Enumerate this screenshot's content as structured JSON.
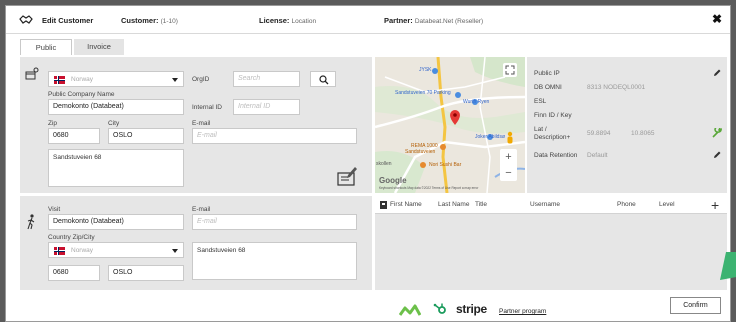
{
  "header": {
    "title": "Edit Customer",
    "customer_label": "Customer:",
    "customer_value": "(1-10)",
    "license_label": "License:",
    "license_value": "Location",
    "partner_label": "Partner:",
    "partner_value": "Databeat.Net (Reseller)",
    "close": "✖"
  },
  "tabs": [
    {
      "label": "Public"
    },
    {
      "label": "Invoice"
    }
  ],
  "company": {
    "country": "Norway",
    "orgid_label": "OrgID",
    "orgid_placeholder": "Search",
    "public_name_label": "Public Company Name",
    "public_name_value": "Demokonto (Databeat)",
    "internal_id_label": "Internal ID",
    "internal_id_placeholder": "Internal ID",
    "zip_label": "Zip",
    "zip_value": "0680",
    "city_label": "City",
    "city_value": "OSLO",
    "email_label": "E-mail",
    "email_placeholder": "E-mail",
    "address_value": "Sandstuveien 68"
  },
  "visit": {
    "visit_label": "Visit",
    "visit_value": "Demokonto (Databeat)",
    "email_label": "E-mail",
    "email_placeholder": "E-mail",
    "country_zip_city_label": "Country Zip/City",
    "country": "Norway",
    "address_value": "Sandstuveien 68",
    "zip_value": "0680",
    "city_value": "OSLO"
  },
  "map": {
    "labels": {
      "jysk": "JYSK",
      "parking": "Sandstuveien 70 Parking",
      "wurth": "Wurth Ryen",
      "joker": "Joker Abildsø",
      "rema": "REMA 1000",
      "rema_sub": "Sandstuveien",
      "nori": "Nori Sushi Bar",
      "kollen": "skollen",
      "google": "Google",
      "attribution": "Keyboard shortcuts   Map data ©2022   Terms of Use   Report a map error"
    },
    "zoom_in": "+",
    "zoom_out": "−"
  },
  "info": {
    "public_ip_label": "Public IP",
    "db_omni_label": "DB OMNI",
    "db_omni_value": "8313 NODEQL0001",
    "esl_label": "ESL",
    "finn_label": "Finn ID / Key",
    "latlon_label": "Lat /",
    "latlon_label2": "Description+",
    "lat_value": "59.8894",
    "lon_value": "10.8065",
    "retention_label": "Data Retention",
    "retention_value": "Default"
  },
  "contacts": {
    "columns": [
      "First Name",
      "Last Name",
      "Title",
      "Username",
      "Phone",
      "Level"
    ],
    "add": "+"
  },
  "footer": {
    "stripe": "stripe",
    "partner_program": "Partner program",
    "confirm": "Confirm"
  },
  "colors": {
    "panel": "#e6e6e6",
    "accent_green": "#6cc04a",
    "hubspot_green": "#1a9b5c",
    "corner_green": "#3cb371"
  }
}
